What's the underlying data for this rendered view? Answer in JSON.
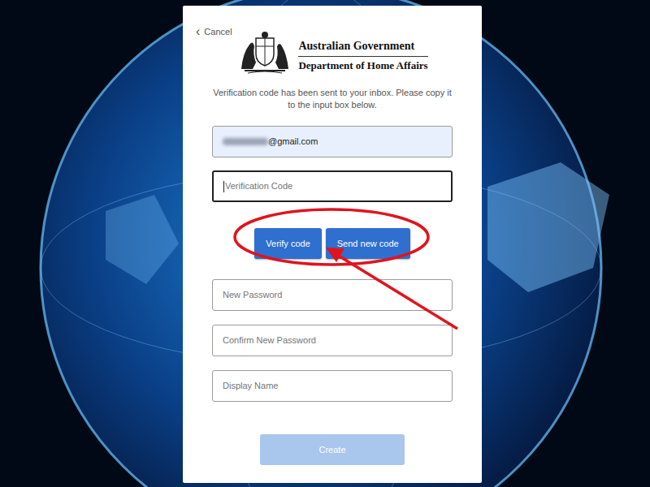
{
  "cancel": {
    "label": "Cancel",
    "icon": "‹"
  },
  "logo": {
    "line1": "Australian Government",
    "line2": "Department of Home Affairs"
  },
  "instruction": "Verification code has been sent to your inbox. Please copy it to the input box below.",
  "email": {
    "value": "@gmail.com",
    "redacted": true
  },
  "verification": {
    "placeholder": "Verification Code",
    "focused": true
  },
  "buttons": [
    {
      "label": "Verify code"
    },
    {
      "label": "Send new code"
    }
  ],
  "fields": [
    {
      "placeholder": "New Password",
      "focused": false
    },
    {
      "placeholder": "Confirm New Password",
      "focused": false
    },
    {
      "placeholder": "Display Name",
      "focused": false
    }
  ],
  "create": {
    "label": "Create",
    "disabled": true
  },
  "annotation": {
    "visible": true
  }
}
